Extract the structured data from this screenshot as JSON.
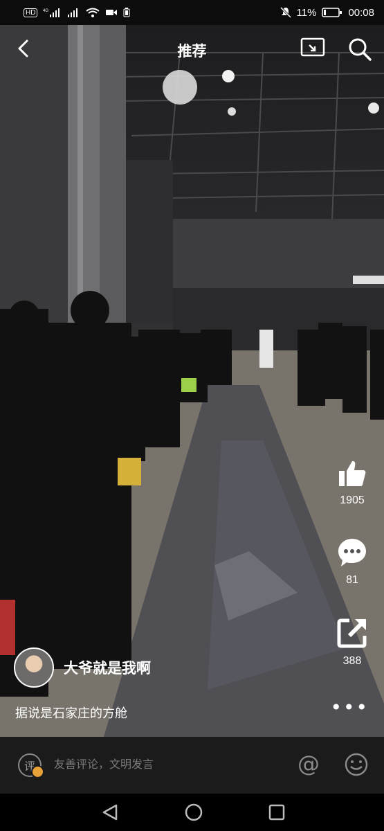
{
  "status_bar": {
    "left_icons": [
      "hd-icon",
      "signal-4g-icon",
      "signal-icon",
      "wifi-icon",
      "video-icon",
      "battery-small-icon"
    ],
    "battery_percent": "11%",
    "time": "00:08"
  },
  "header": {
    "title": "推荐",
    "back_icon": "chevron-left-icon",
    "cast_icon": "screen-cast-icon",
    "search_icon": "search-icon"
  },
  "side_actions": {
    "likes": "1905",
    "comments": "81",
    "shares": "388",
    "more": "•••"
  },
  "post": {
    "author": "大爷就是我啊",
    "caption": "据说是石家庄的方舱"
  },
  "comment_bar": {
    "icon_label": "评",
    "placeholder": "友善评论，文明发言",
    "at_icon": "@",
    "emoji_icon": "smile-icon"
  },
  "colors": {
    "accent": "#e8a23a",
    "comment_bar_bg": "#1b1b1b",
    "muted_text": "#7a7a7a"
  }
}
